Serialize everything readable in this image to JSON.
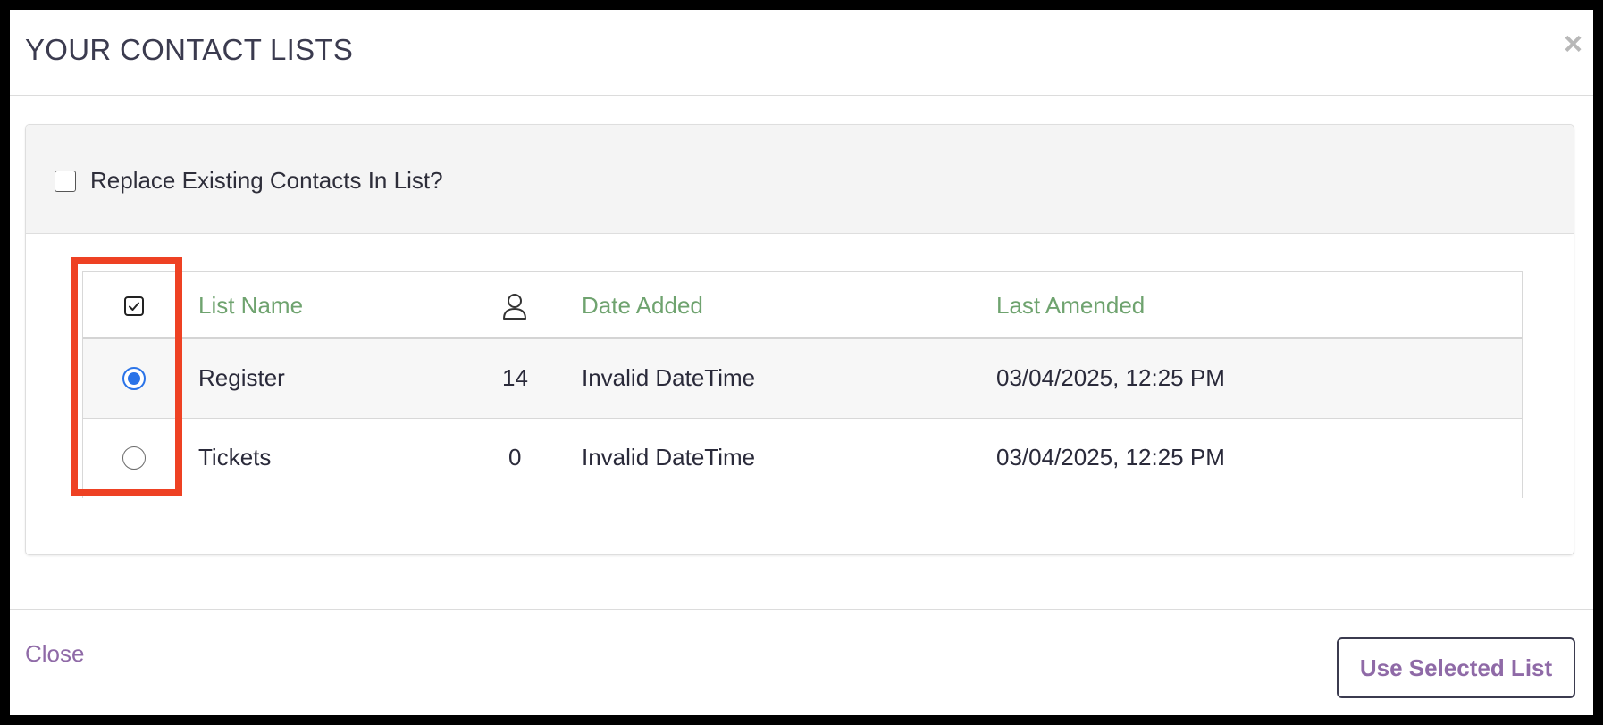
{
  "dialog": {
    "title": "YOUR CONTACT LISTS",
    "close_icon": "×"
  },
  "options": {
    "replace_label": "Replace Existing Contacts In List?",
    "replace_checked": false
  },
  "table": {
    "headers": {
      "select_icon": "checkbox-check-icon",
      "list_name": "List Name",
      "contacts_icon": "person-icon",
      "date_added": "Date Added",
      "last_amended": "Last Amended"
    },
    "rows": [
      {
        "selected": true,
        "list_name": "Register",
        "count": "14",
        "date_added": "Invalid DateTime",
        "last_amended": "03/04/2025, 12:25 PM"
      },
      {
        "selected": false,
        "list_name": "Tickets",
        "count": "0",
        "date_added": "Invalid DateTime",
        "last_amended": "03/04/2025, 12:25 PM"
      }
    ]
  },
  "footer": {
    "close_label": "Close",
    "use_label": "Use Selected List"
  },
  "colors": {
    "header_text": "#6fa36f",
    "link_purple": "#8f6aa7",
    "radio_selected": "#2a73e8",
    "highlight": "#ee4123"
  }
}
